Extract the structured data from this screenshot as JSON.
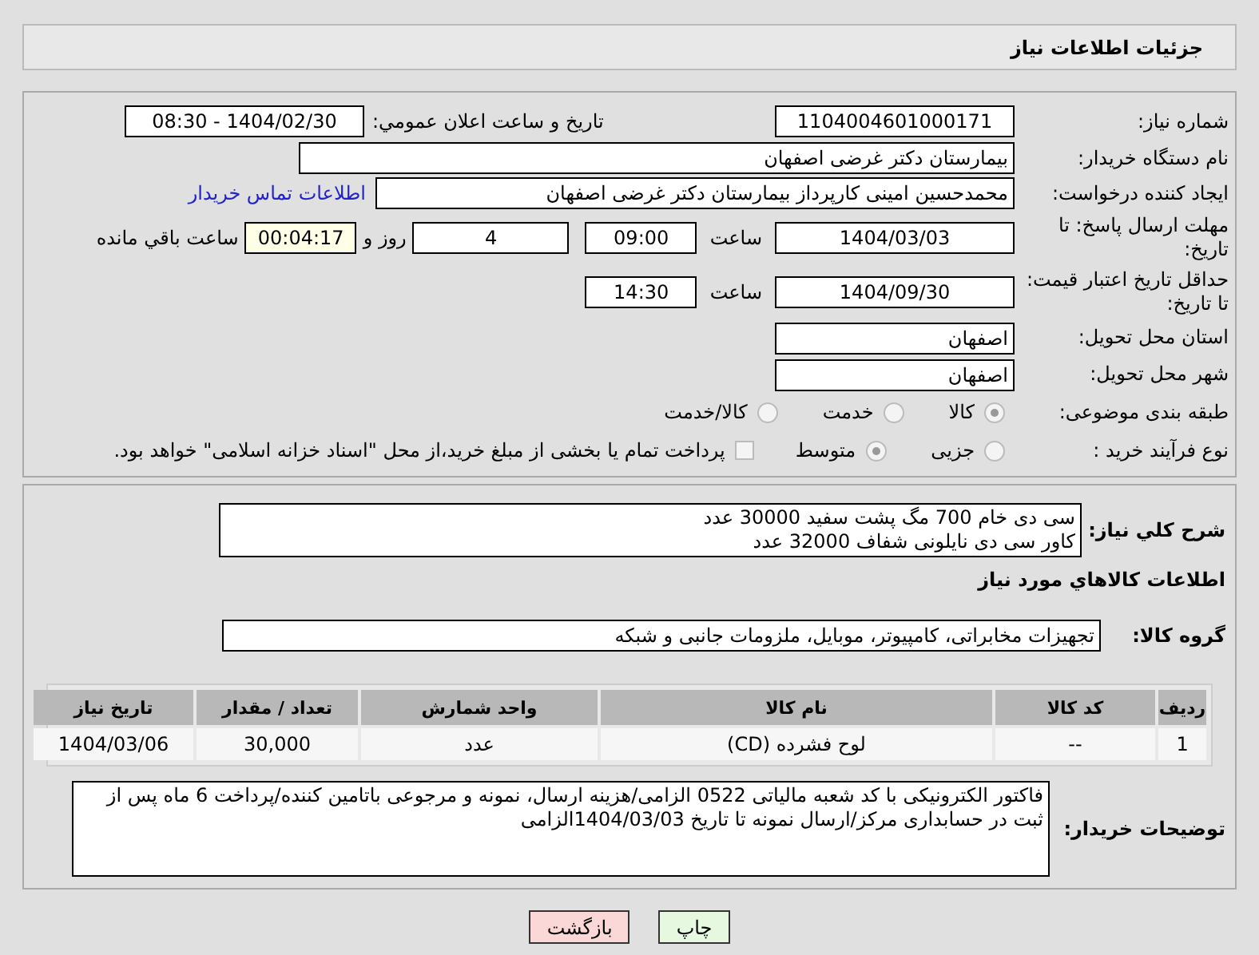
{
  "header": {
    "title": "جزئیات اطلاعات نیاز"
  },
  "fields": {
    "need_number": {
      "label": "شماره نیاز:",
      "value": "1104004601000171"
    },
    "announce": {
      "label": "تاریخ و ساعت اعلان عمومي:",
      "value": "1404/02/30 - 08:30"
    },
    "buyer": {
      "label": "نام دستگاه خریدار:",
      "value": "بیمارستان دکتر غرضی اصفهان"
    },
    "creator": {
      "label": "ایجاد کننده درخواست:",
      "value": "محمدحسین امینی کارپرداز بیمارستان دکتر غرضی اصفهان",
      "link": "اطلاعات تماس خریدار"
    },
    "deadline": {
      "label": "مهلت ارسال پاسخ: تا تاریخ:",
      "date": "1404/03/03",
      "time_label": "ساعت",
      "time": "09:00",
      "days": "4",
      "days_label": "روز و",
      "remaining": "00:04:17",
      "remaining_label": "ساعت باقي مانده"
    },
    "validity": {
      "label": "حداقل تاریخ اعتبار قیمت: تا تاریخ:",
      "date": "1404/09/30",
      "time_label": "ساعت",
      "time": "14:30"
    },
    "province": {
      "label": "استان محل تحویل:",
      "value": "اصفهان"
    },
    "city": {
      "label": "شهر محل تحویل:",
      "value": "اصفهان"
    }
  },
  "category": {
    "label": "طبقه بندی موضوعی:",
    "options": [
      {
        "label": "کالا",
        "selected": true
      },
      {
        "label": "خدمت",
        "selected": false
      },
      {
        "label": "کالا/خدمت",
        "selected": false
      }
    ]
  },
  "process": {
    "label": "نوع فرآیند خرید :",
    "options": [
      {
        "label": "جزیی",
        "selected": false
      },
      {
        "label": "متوسط",
        "selected": true
      }
    ],
    "payment": {
      "checked": false,
      "label": "پرداخت تمام یا بخشی از مبلغ خرید،از محل \"اسناد خزانه اسلامی\" خواهد بود."
    }
  },
  "summary": {
    "label": "شرح کلي نياز:",
    "lines": [
      "سی دی خام 700 مگ پشت سفید 30000 عدد",
      "کاور سی دی نایلونی شفاف 32000 عدد"
    ]
  },
  "goods_title": "اطلاعات کالاهاي مورد نياز",
  "group": {
    "label": "گروه کالا:",
    "value": "تجهیزات مخابراتی، کامپیوتر، موبایل، ملزومات جانبی و شبکه"
  },
  "table": {
    "columns": [
      "ردیف",
      "کد کالا",
      "نام کالا",
      "واحد شمارش",
      "تعداد / مقدار",
      "تاریخ نیاز"
    ],
    "rows": [
      [
        "1",
        "--",
        "لوح فشرده (CD)",
        "عدد",
        "30,000",
        "1404/03/06"
      ]
    ]
  },
  "notes": {
    "label": "توضیحات خریدار:",
    "text": "فاکتور الکترونیکی با کد شعبه مالیاتی 0522 الزامی/هزینه ارسال، نمونه و مرجوعی باتامین کننده/پرداخت 6 ماه پس از ثبت در حسابداری مرکز/ارسال نمونه تا تاریخ 1404/03/03الزامی"
  },
  "buttons": [
    {
      "label": "چاپ",
      "kind": "print"
    },
    {
      "label": "بازگشت",
      "kind": "back"
    }
  ]
}
